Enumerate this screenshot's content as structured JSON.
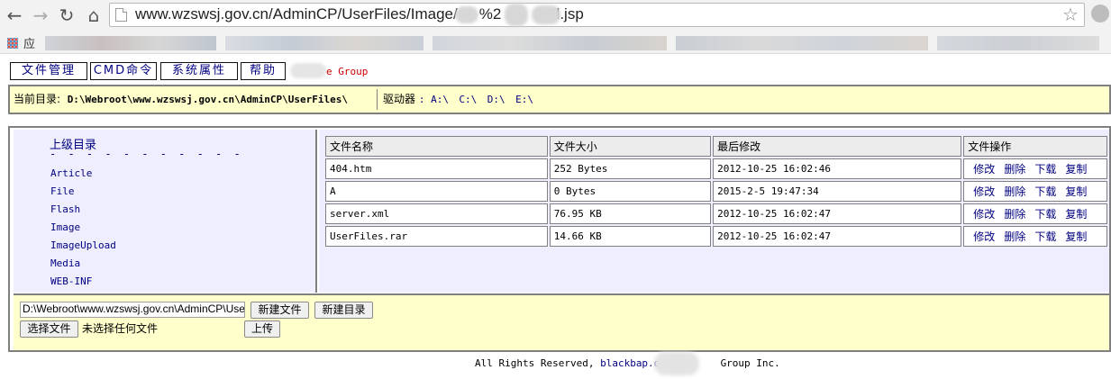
{
  "browser": {
    "url_visible_start": "www.wzswsj.gov.cn/AdminCP/UserFiles/Image/",
    "url_visible_mid": "%2",
    "url_visible_end": "ell.jsp",
    "bookmarks_label": "应"
  },
  "nav": {
    "items": [
      "文件管理",
      "CMD命令",
      "系统属性",
      "帮助"
    ],
    "brand_text": "e Group"
  },
  "dirbar": {
    "current_label": "当前目录:",
    "current_path": "D:\\Webroot\\www.wzswsj.gov.cn\\AdminCP\\UserFiles\\",
    "drives_label": "驱动器",
    "drives": [
      "A:\\",
      "C:\\",
      "D:\\",
      "E:\\"
    ]
  },
  "sidebar": {
    "up_label": "上级目录",
    "dash_line": "- - - - - - - - - - -",
    "folders": [
      "Article",
      "File",
      "Flash",
      "Image",
      "ImageUpload",
      "Media",
      "WEB-INF"
    ]
  },
  "table": {
    "headers": [
      "文件名称",
      "文件大小",
      "最后修改",
      "文件操作"
    ],
    "ops": [
      "修改",
      "删除",
      "下载",
      "复制"
    ],
    "rows": [
      {
        "name": "404.htm",
        "size": "252 Bytes",
        "modified": "2012-10-25 16:02:46"
      },
      {
        "name": "A",
        "size": "0 Bytes",
        "modified": "2015-2-5 19:47:34"
      },
      {
        "name": "server.xml",
        "size": "76.95 KB",
        "modified": "2012-10-25 16:02:47"
      },
      {
        "name": "UserFiles.rar",
        "size": "14.66 KB",
        "modified": "2012-10-25 16:02:47"
      }
    ]
  },
  "upload": {
    "path_value": "D:\\Webroot\\www.wzswsj.gov.cn\\AdminCP\\UserFiles\\",
    "new_file_label": "新建文件",
    "new_dir_label": "新建目录",
    "choose_file_label": "选择文件",
    "no_file_label": "未选择任何文件",
    "upload_label": "上传"
  },
  "footer": {
    "prefix": "All Rights Reserved,",
    "link": "blackbap.org",
    "suffix": "Group Inc."
  },
  "colors": {
    "link": "#000080",
    "panel_yellow": "#ffffcc",
    "panel_lavender": "#eeeeff",
    "brand_red": "#cc0000"
  }
}
